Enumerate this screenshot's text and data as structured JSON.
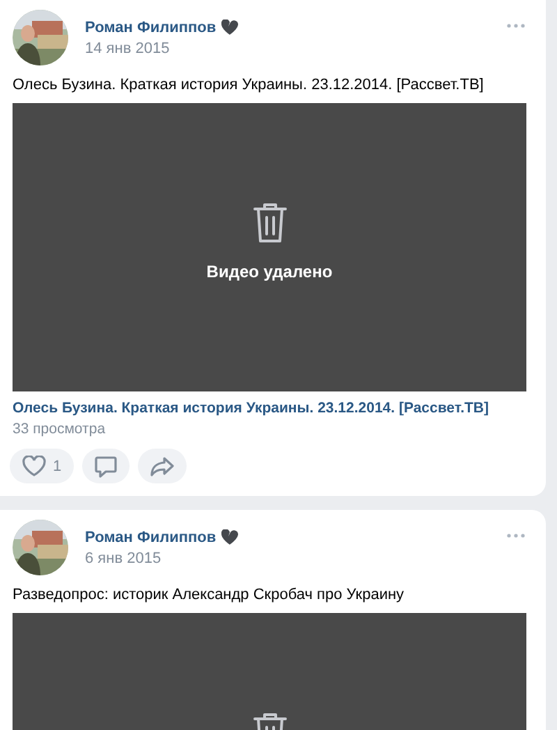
{
  "posts": [
    {
      "author": "Роман Филиппов",
      "date": "14 янв 2015",
      "text": "Олесь Бузина. Краткая история Украины. 23.12.2014. [Рассвет.ТВ]",
      "video": {
        "kind": "deleted",
        "caption": "Видео удалено"
      },
      "video_title": "Олесь Бузина. Краткая история Украины. 23.12.2014. [Рассвет.ТВ]",
      "views": "33 просмотра",
      "actions": [
        {
          "kind": "like",
          "count": "1",
          "selected": false
        },
        {
          "kind": "comment"
        },
        {
          "kind": "share"
        }
      ]
    },
    {
      "author": "Роман Филиппов",
      "date": "6 янв 2015",
      "text": "Разведопрос: историк Александр Скробач про Украину",
      "video": {
        "kind": "deleted"
      }
    }
  ]
}
